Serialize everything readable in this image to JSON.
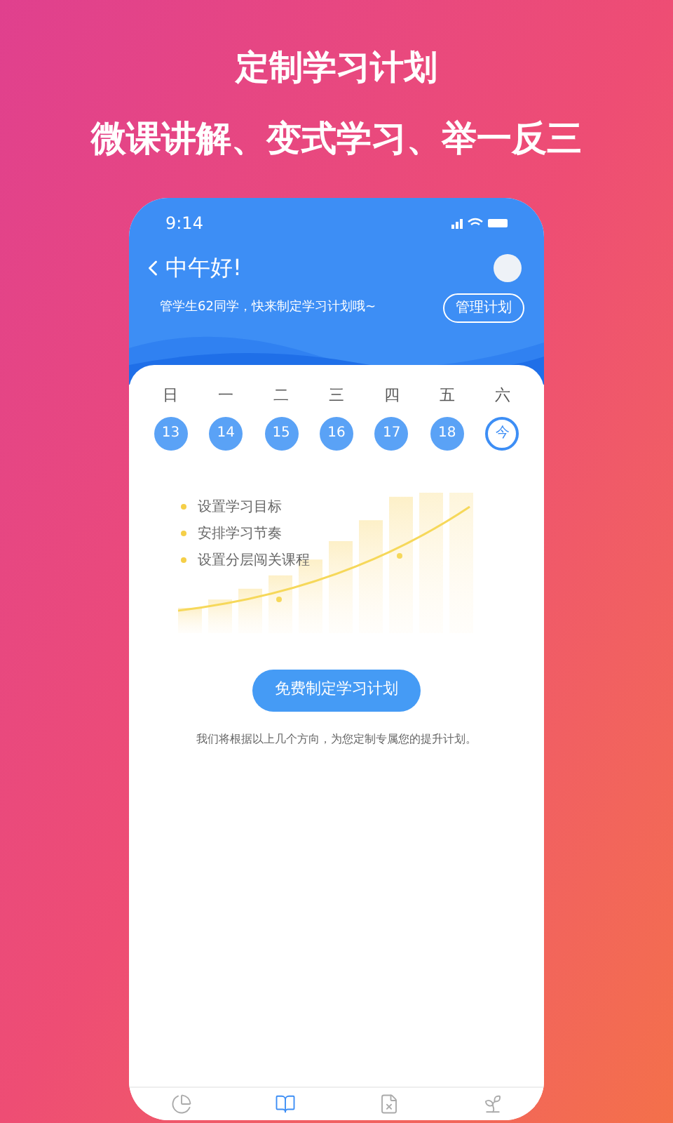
{
  "headline": "定制学习计划",
  "subheadline": "微课讲解、变式学习、举一反三",
  "phone": {
    "time": "9:14",
    "greeting": "中午好!",
    "message": "管学生62同学，快来制定学习计划哦~",
    "manage_button": "管理计划",
    "days": [
      {
        "weekday": "日",
        "date": "13",
        "selected": false
      },
      {
        "weekday": "一",
        "date": "14",
        "selected": false
      },
      {
        "weekday": "二",
        "date": "15",
        "selected": false
      },
      {
        "weekday": "三",
        "date": "16",
        "selected": false
      },
      {
        "weekday": "四",
        "date": "17",
        "selected": false
      },
      {
        "weekday": "五",
        "date": "18",
        "selected": false
      },
      {
        "weekday": "六",
        "date": "今",
        "selected": true
      }
    ],
    "steps": [
      "设置学习目标",
      "安排学习节奏",
      "设置分层闯关课程"
    ],
    "cta_button": "免费制定学习计划",
    "note": "我们将根据以上几个方向，为您定制专属您的提升计划。",
    "tabs": [
      {
        "kind": "report",
        "selected": false
      },
      {
        "kind": "course",
        "selected": true
      },
      {
        "kind": "practice",
        "selected": false
      },
      {
        "kind": "profile",
        "selected": false
      }
    ]
  }
}
